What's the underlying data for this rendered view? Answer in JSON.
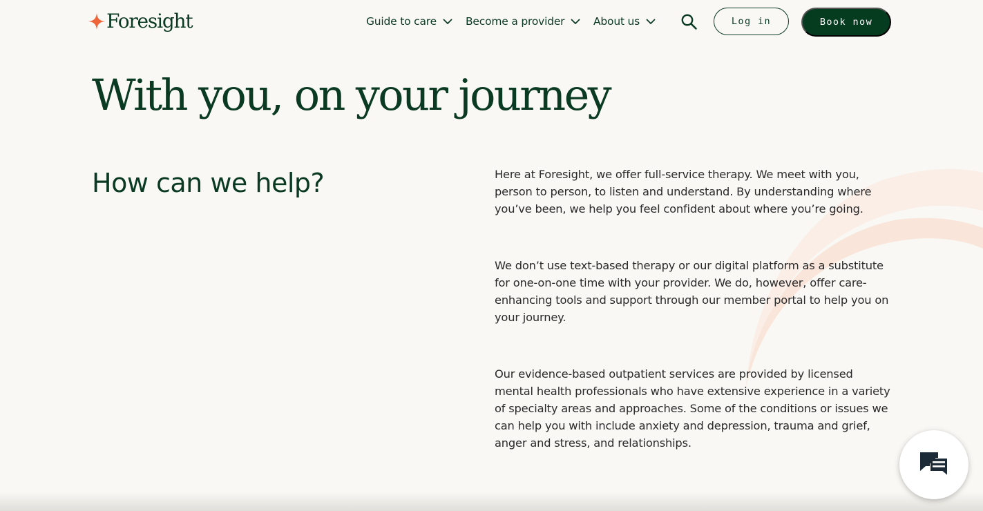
{
  "brand": {
    "name": "Foresight",
    "star_color": "#f0643a",
    "primary_color": "#0b3a22"
  },
  "nav": {
    "items": [
      {
        "label": "Guide to care",
        "icon": "chevron-down-icon"
      },
      {
        "label": "Become a provider",
        "icon": "chevron-down-icon"
      },
      {
        "label": "About us",
        "icon": "chevron-down-icon"
      }
    ],
    "search_icon": "search-icon",
    "login_label": "Log in",
    "book_label": "Book now"
  },
  "hero": {
    "title": "With you, on your journey",
    "subtitle": "How can we help?",
    "paragraphs": [
      "Here at Foresight, we offer full-service therapy. We meet with you, person to person, to listen and understand. By understanding where you’ve been, we help you feel confident about where you’re going.",
      "We don’t use text-based therapy or our digital platform as a substitute for one-on-one time with your provider. We do, however, offer care-enhancing tools and support through our member portal to help you on your journey.",
      "Our evidence-based outpatient services are provided by licensed mental health professionals who have extensive experience in a variety of specialty areas and approaches. Some of the conditions or issues we can help you with include anxiety and depression, trauma and grief, anger and stress, and relationships."
    ]
  },
  "chat": {
    "icon": "chat-icon"
  }
}
